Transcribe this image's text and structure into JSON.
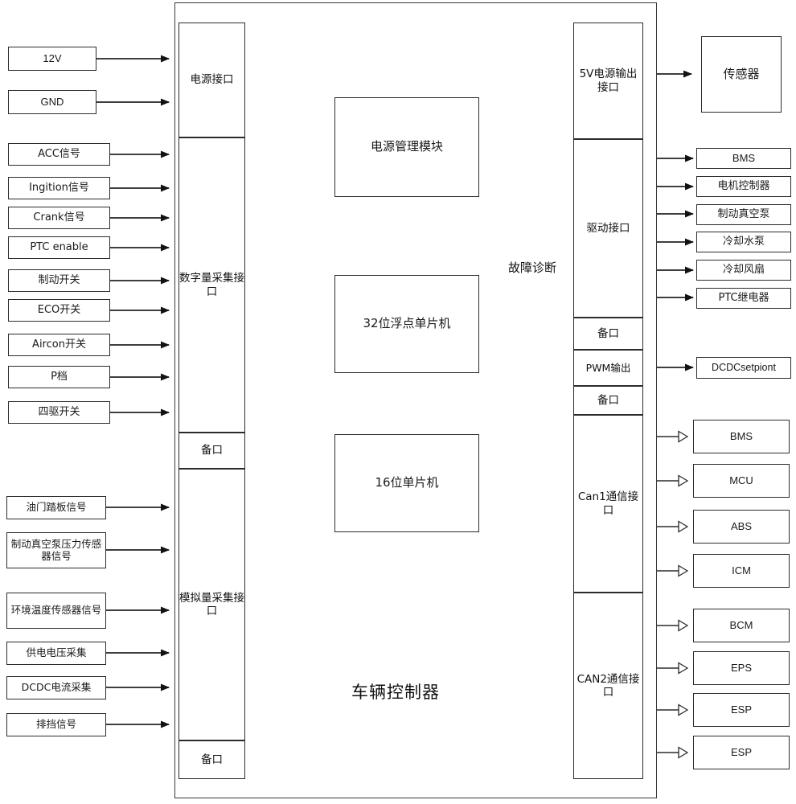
{
  "diagram": {
    "title": "车辆控制器",
    "fault_label": "故障诊断",
    "colors": {
      "line": "#2b2b2b",
      "fill": "#ffffff",
      "text": "#1a1a1a"
    }
  },
  "left_inputs": [
    {
      "label": "12V"
    },
    {
      "label": "GND"
    },
    {
      "label": "ACC信号"
    },
    {
      "label": "Ingition信号"
    },
    {
      "label": "Crank信号"
    },
    {
      "label": "PTC enable"
    },
    {
      "label": "制动开关"
    },
    {
      "label": "ECO开关"
    },
    {
      "label": "Aircon开关"
    },
    {
      "label": "P档"
    },
    {
      "label": "四驱开关"
    },
    {
      "label": "油门踏板信号"
    },
    {
      "label": "制动真空泵压力传感器信号"
    },
    {
      "label": "环境温度传感器信号"
    },
    {
      "label": "供电电压采集"
    },
    {
      "label": "DCDC电流采集"
    },
    {
      "label": "排挡信号"
    }
  ],
  "left_column": [
    {
      "label": "电源接口"
    },
    {
      "label": "数字量采集接口"
    },
    {
      "label": "备口"
    },
    {
      "label": "模拟量采集接口"
    },
    {
      "label": "备口"
    }
  ],
  "core_modules": [
    {
      "label": "电源管理模块"
    },
    {
      "label": "32位浮点单片机"
    },
    {
      "label": "16位单片机"
    }
  ],
  "right_column": [
    {
      "label": "5V电源输出接口"
    },
    {
      "label": "驱动接口"
    },
    {
      "label": "备口"
    },
    {
      "label": "PWM输出"
    },
    {
      "label": "备口"
    },
    {
      "label": "Can1通信接口"
    },
    {
      "label": "CAN2通信接口"
    }
  ],
  "right_outputs": {
    "power5v": [
      {
        "label": "传感器"
      }
    ],
    "drive": [
      {
        "label": "BMS"
      },
      {
        "label": "电机控制器"
      },
      {
        "label": "制动真空泵"
      },
      {
        "label": "冷却水泵"
      },
      {
        "label": "冷却风扇"
      },
      {
        "label": "PTC继电器"
      }
    ],
    "pwm": [
      {
        "label": "DCDCsetpiont"
      }
    ],
    "can1": [
      {
        "label": "BMS"
      },
      {
        "label": "MCU"
      },
      {
        "label": "ABS"
      },
      {
        "label": "ICM"
      }
    ],
    "can2": [
      {
        "label": "BCM"
      },
      {
        "label": "EPS"
      },
      {
        "label": "ESP"
      },
      {
        "label": "ESP"
      }
    ]
  }
}
